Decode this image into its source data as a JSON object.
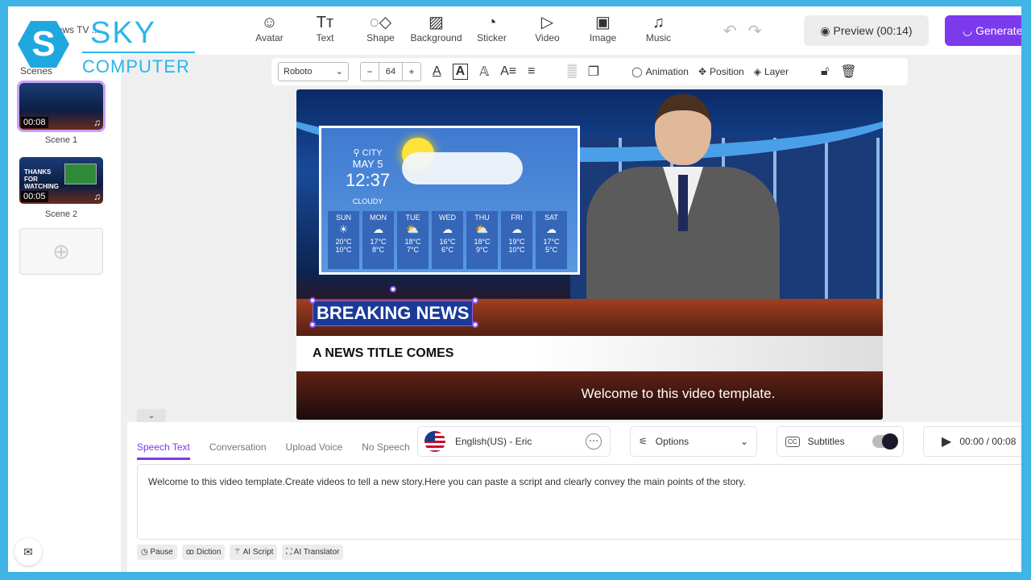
{
  "project": {
    "title": "News TV ..."
  },
  "logo": {
    "text1": "SKY",
    "text2": "COMPUTER",
    "mark": "S"
  },
  "toolbar": {
    "items": [
      {
        "label": "Avatar",
        "icon": "avatar-icon",
        "glyph": "☺"
      },
      {
        "label": "Text",
        "icon": "text-icon",
        "glyph": "Tт"
      },
      {
        "label": "Shape",
        "icon": "shape-icon",
        "glyph": "◌◇"
      },
      {
        "label": "Background",
        "icon": "background-icon",
        "glyph": "▨"
      },
      {
        "label": "Sticker",
        "icon": "sticker-icon",
        "glyph": "◔"
      },
      {
        "label": "Video",
        "icon": "video-icon",
        "glyph": "▷"
      },
      {
        "label": "Image",
        "icon": "image-icon",
        "glyph": "▣"
      },
      {
        "label": "Music",
        "icon": "music-icon",
        "glyph": "♫"
      }
    ],
    "preview": "Preview (00:14)",
    "generate": "Generate"
  },
  "sidebar": {
    "label": "Scenes",
    "scenes": [
      {
        "name": "Scene 1",
        "duration": "00:08"
      },
      {
        "name": "Scene 2",
        "duration": "00:05",
        "thumb_text": "THANKS FOR WATCHING"
      }
    ]
  },
  "format": {
    "font": "Roboto",
    "size": "64",
    "animation": "Animation",
    "position": "Position",
    "layer": "Layer"
  },
  "stage": {
    "weather": {
      "city": "CITY",
      "date": "MAY 5",
      "time": "12:37",
      "condition": "CLOUDY",
      "days": [
        {
          "d": "SUN",
          "hi": "20°C",
          "lo": "10°C",
          "i": "☀"
        },
        {
          "d": "MON",
          "hi": "17°C",
          "lo": "8°C",
          "i": "☁"
        },
        {
          "d": "TUE",
          "hi": "18°C",
          "lo": "7°C",
          "i": "⛅"
        },
        {
          "d": "WED",
          "hi": "16°C",
          "lo": "6°C",
          "i": "☁"
        },
        {
          "d": "THU",
          "hi": "18°C",
          "lo": "9°C",
          "i": "⛅"
        },
        {
          "d": "FRI",
          "hi": "19°C",
          "lo": "10°C",
          "i": "☁"
        },
        {
          "d": "SAT",
          "hi": "17°C",
          "lo": "5°C",
          "i": "☁"
        }
      ]
    },
    "breaking": "BREAKING NEWS",
    "title": "A NEWS TITLE COMES HERE",
    "subtitle": "Welcome to this video template."
  },
  "speech": {
    "tabs": [
      "Speech Text",
      "Conversation",
      "Upload Voice",
      "No Speech"
    ],
    "active_tab": "Speech Text",
    "voice": "English(US) - Eric",
    "options": "Options",
    "subtitles": "Subtitles",
    "subtitles_on": true,
    "time": "00:00 / 00:08",
    "script": "Welcome to this video template.Create videos to tell a new story.Here you can paste a script and clearly convey the main points of the story.",
    "chips": [
      "Pause",
      "Diction",
      "AI Script",
      "AI Translator"
    ]
  },
  "colors": {
    "accent": "#7c3aed",
    "frame": "#41b4e6"
  }
}
